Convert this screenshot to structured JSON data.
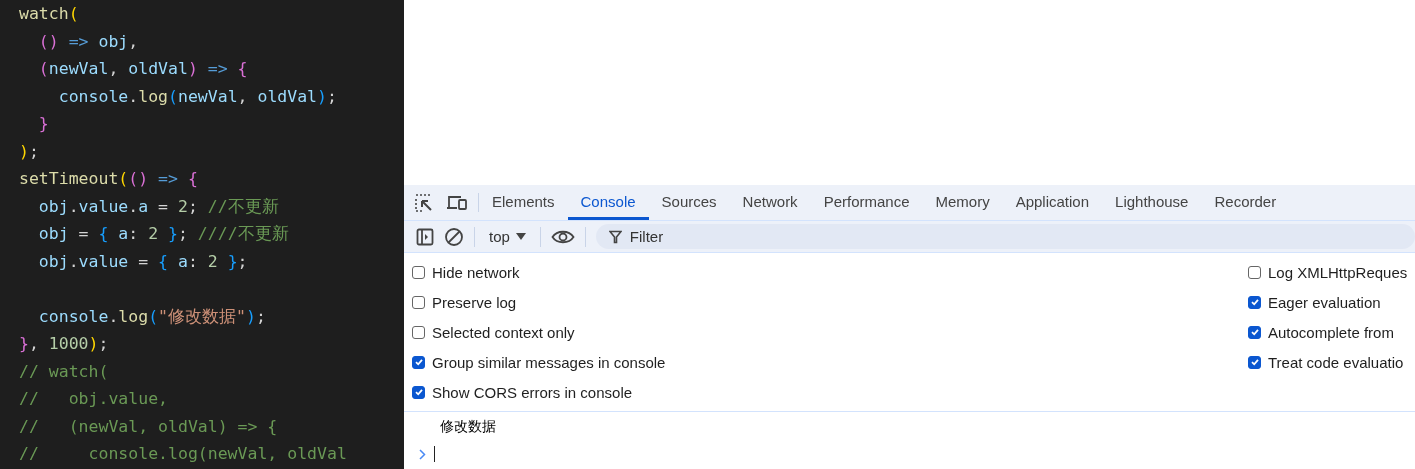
{
  "editor": {
    "lines": [
      {
        "kind": "code",
        "tokens": [
          {
            "text": "watch",
            "kind": "fn"
          },
          {
            "text": "(",
            "kind": "b1"
          }
        ]
      },
      {
        "kind": "code",
        "tokens": [
          {
            "text": "  ()",
            "kind": "b2"
          },
          {
            "text": " => ",
            "kind": "kw"
          },
          {
            "text": "obj",
            "kind": "var"
          },
          {
            "text": ",",
            "kind": "plain"
          }
        ]
      },
      {
        "kind": "code",
        "tokens": [
          {
            "text": "  (",
            "kind": "b2"
          },
          {
            "text": "newVal",
            "kind": "var"
          },
          {
            "text": ", ",
            "kind": "plain"
          },
          {
            "text": "oldVal",
            "kind": "var"
          },
          {
            "text": ")",
            "kind": "b2"
          },
          {
            "text": " => ",
            "kind": "kw"
          },
          {
            "text": "{",
            "kind": "b2"
          }
        ]
      },
      {
        "kind": "code",
        "tokens": [
          {
            "text": "    console",
            "kind": "var"
          },
          {
            "text": ".",
            "kind": "plain"
          },
          {
            "text": "log",
            "kind": "fn"
          },
          {
            "text": "(",
            "kind": "b3"
          },
          {
            "text": "newVal",
            "kind": "var"
          },
          {
            "text": ", ",
            "kind": "plain"
          },
          {
            "text": "oldVal",
            "kind": "var"
          },
          {
            "text": ")",
            "kind": "b3"
          },
          {
            "text": ";",
            "kind": "plain"
          }
        ]
      },
      {
        "kind": "code",
        "tokens": [
          {
            "text": "  }",
            "kind": "b2"
          }
        ]
      },
      {
        "kind": "code",
        "tokens": [
          {
            "text": ")",
            "kind": "b1"
          },
          {
            "text": ";",
            "kind": "plain"
          }
        ]
      },
      {
        "kind": "code",
        "tokens": [
          {
            "text": "setTimeout",
            "kind": "fn"
          },
          {
            "text": "(",
            "kind": "b1"
          },
          {
            "text": "()",
            "kind": "b2"
          },
          {
            "text": " => ",
            "kind": "kw"
          },
          {
            "text": "{",
            "kind": "b2"
          }
        ]
      },
      {
        "kind": "code",
        "tokens": [
          {
            "text": "  obj",
            "kind": "var"
          },
          {
            "text": ".",
            "kind": "plain"
          },
          {
            "text": "value",
            "kind": "var"
          },
          {
            "text": ".",
            "kind": "plain"
          },
          {
            "text": "a",
            "kind": "var"
          },
          {
            "text": " = ",
            "kind": "plain"
          },
          {
            "text": "2",
            "kind": "num"
          },
          {
            "text": "; ",
            "kind": "plain"
          },
          {
            "text": "//不更新",
            "kind": "comment"
          }
        ]
      },
      {
        "kind": "code",
        "tokens": [
          {
            "text": "  obj",
            "kind": "var"
          },
          {
            "text": " = ",
            "kind": "plain"
          },
          {
            "text": "{",
            "kind": "b3"
          },
          {
            "text": " a",
            "kind": "var"
          },
          {
            "text": ": ",
            "kind": "plain"
          },
          {
            "text": "2",
            "kind": "num"
          },
          {
            "text": " }",
            "kind": "b3"
          },
          {
            "text": "; ",
            "kind": "plain"
          },
          {
            "text": "////不更新",
            "kind": "comment"
          }
        ]
      },
      {
        "kind": "code",
        "tokens": [
          {
            "text": "  obj",
            "kind": "var"
          },
          {
            "text": ".",
            "kind": "plain"
          },
          {
            "text": "value",
            "kind": "var"
          },
          {
            "text": " = ",
            "kind": "plain"
          },
          {
            "text": "{",
            "kind": "b3"
          },
          {
            "text": " a",
            "kind": "var"
          },
          {
            "text": ": ",
            "kind": "plain"
          },
          {
            "text": "2",
            "kind": "num"
          },
          {
            "text": " }",
            "kind": "b3"
          },
          {
            "text": ";",
            "kind": "plain"
          }
        ]
      },
      {
        "kind": "blank"
      },
      {
        "kind": "code",
        "tokens": [
          {
            "text": "  console",
            "kind": "var"
          },
          {
            "text": ".",
            "kind": "plain"
          },
          {
            "text": "log",
            "kind": "fn"
          },
          {
            "text": "(",
            "kind": "b3"
          },
          {
            "text": "\"修改数据\"",
            "kind": "str"
          },
          {
            "text": ")",
            "kind": "b3"
          },
          {
            "text": ";",
            "kind": "plain"
          }
        ]
      },
      {
        "kind": "code",
        "tokens": [
          {
            "text": "}",
            "kind": "b2"
          },
          {
            "text": ", ",
            "kind": "plain"
          },
          {
            "text": "1000",
            "kind": "num"
          },
          {
            "text": ")",
            "kind": "b1"
          },
          {
            "text": ";",
            "kind": "plain"
          }
        ]
      },
      {
        "kind": "code",
        "tokens": [
          {
            "text": "// watch(",
            "kind": "comment"
          }
        ]
      },
      {
        "kind": "code",
        "tokens": [
          {
            "text": "//   obj.value,",
            "kind": "comment"
          }
        ]
      },
      {
        "kind": "code",
        "tokens": [
          {
            "text": "//   (newVal, oldVal) => {",
            "kind": "comment"
          }
        ]
      },
      {
        "kind": "code",
        "tokens": [
          {
            "text": "//     console.log(newVal, oldVal",
            "kind": "comment"
          }
        ]
      }
    ]
  },
  "devtools": {
    "tabs": [
      {
        "label": "Elements",
        "selected": false
      },
      {
        "label": "Console",
        "selected": true
      },
      {
        "label": "Sources",
        "selected": false
      },
      {
        "label": "Network",
        "selected": false
      },
      {
        "label": "Performance",
        "selected": false
      },
      {
        "label": "Memory",
        "selected": false
      },
      {
        "label": "Application",
        "selected": false
      },
      {
        "label": "Lighthouse",
        "selected": false
      },
      {
        "label": "Recorder",
        "selected": false
      }
    ],
    "toolbar": {
      "context": "top",
      "filter_placeholder": "Filter"
    },
    "settings_left": [
      {
        "label": "Hide network",
        "checked": false
      },
      {
        "label": "Preserve log",
        "checked": false
      },
      {
        "label": "Selected context only",
        "checked": false
      },
      {
        "label": "Group similar messages in console",
        "checked": true
      },
      {
        "label": "Show CORS errors in console",
        "checked": true
      }
    ],
    "settings_right": [
      {
        "label": "Log XMLHttpReques",
        "checked": false
      },
      {
        "label": "Eager evaluation",
        "checked": true
      },
      {
        "label": "Autocomplete from",
        "checked": true
      },
      {
        "label": "Treat code evaluatio",
        "checked": true
      }
    ],
    "messages": [
      {
        "text": "修改数据"
      }
    ]
  }
}
